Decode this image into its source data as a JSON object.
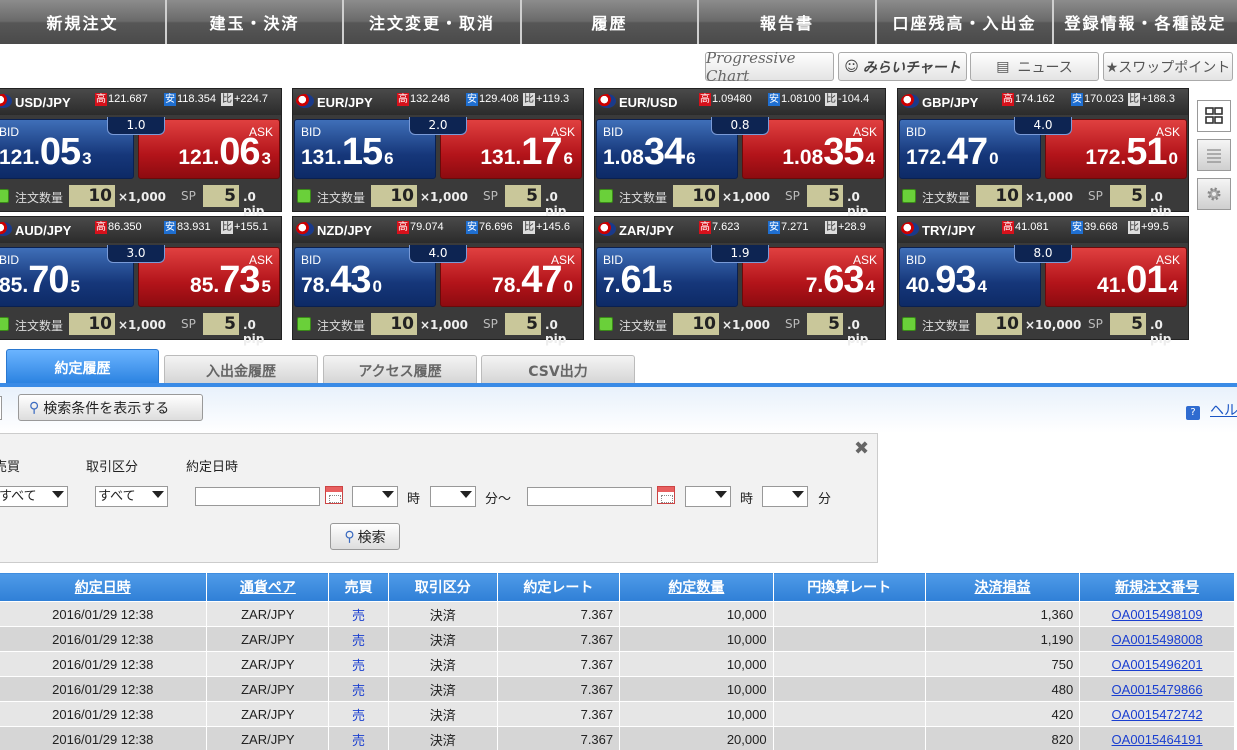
{
  "nav": [
    "新規注文",
    "建玉・決済",
    "注文変更・取消",
    "履歴",
    "報告書",
    "口座残高・入出金",
    "登録情報・各種設定"
  ],
  "tools": {
    "progressive": "Progressive Chart",
    "mirai": "みらいチャート",
    "news": "ニュース",
    "swap": "★スワップポイント"
  },
  "panels": [
    {
      "pair": "USD/JPY",
      "hi": "121.687",
      "lo": "118.354",
      "ch": "+224.7",
      "spread": "1.0",
      "bid": {
        "s": "121.",
        "b": "05",
        "t": "3"
      },
      "ask": {
        "s": "121.",
        "b": "06",
        "t": "3"
      },
      "qty": "10",
      "unit": "×1,000",
      "sp": "5",
      "sp_unit": ".0 pip"
    },
    {
      "pair": "EUR/JPY",
      "hi": "132.248",
      "lo": "129.408",
      "ch": "+119.3",
      "spread": "2.0",
      "bid": {
        "s": "131.",
        "b": "15",
        "t": "6"
      },
      "ask": {
        "s": "131.",
        "b": "17",
        "t": "6"
      },
      "qty": "10",
      "unit": "×1,000",
      "sp": "5",
      "sp_unit": ".0 pip"
    },
    {
      "pair": "EUR/USD",
      "hi": "1.09480",
      "lo": "1.08100",
      "ch": "-104.4",
      "spread": "0.8",
      "bid": {
        "s": "1.08",
        "b": "34",
        "t": "6"
      },
      "ask": {
        "s": "1.08",
        "b": "35",
        "t": "4"
      },
      "qty": "10",
      "unit": "×1,000",
      "sp": "5",
      "sp_unit": ".0 pip"
    },
    {
      "pair": "GBP/JPY",
      "hi": "174.162",
      "lo": "170.023",
      "ch": "+188.3",
      "spread": "4.0",
      "bid": {
        "s": "172.",
        "b": "47",
        "t": "0"
      },
      "ask": {
        "s": "172.",
        "b": "51",
        "t": "0"
      },
      "qty": "10",
      "unit": "×1,000",
      "sp": "5",
      "sp_unit": ".0 pip"
    },
    {
      "pair": "AUD/JPY",
      "hi": "86.350",
      "lo": "83.931",
      "ch": "+155.1",
      "spread": "3.0",
      "bid": {
        "s": "85.",
        "b": "70",
        "t": "5"
      },
      "ask": {
        "s": "85.",
        "b": "73",
        "t": "5"
      },
      "qty": "10",
      "unit": "×1,000",
      "sp": "5",
      "sp_unit": ".0 pip"
    },
    {
      "pair": "NZD/JPY",
      "hi": "79.074",
      "lo": "76.696",
      "ch": "+145.6",
      "spread": "4.0",
      "bid": {
        "s": "78.",
        "b": "43",
        "t": "0"
      },
      "ask": {
        "s": "78.",
        "b": "47",
        "t": "0"
      },
      "qty": "10",
      "unit": "×1,000",
      "sp": "5",
      "sp_unit": ".0 pip"
    },
    {
      "pair": "ZAR/JPY",
      "hi": "7.623",
      "lo": "7.271",
      "ch": "+28.9",
      "spread": "1.9",
      "bid": {
        "s": "7.",
        "b": "61",
        "t": "5"
      },
      "ask": {
        "s": "7.",
        "b": "63",
        "t": "4"
      },
      "qty": "10",
      "unit": "×1,000",
      "sp": "5",
      "sp_unit": ".0 pip"
    },
    {
      "pair": "TRY/JPY",
      "hi": "41.081",
      "lo": "39.668",
      "ch": "+99.5",
      "spread": "8.0",
      "bid": {
        "s": "40.",
        "b": "93",
        "t": "4"
      },
      "ask": {
        "s": "41.",
        "b": "01",
        "t": "4"
      },
      "qty": "10",
      "unit": "×10,000",
      "sp": "5",
      "sp_unit": ".0 pip"
    }
  ],
  "labels": {
    "hi": "高",
    "lo": "安",
    "ch": "比",
    "bid": "BID",
    "ask": "ASK",
    "qty": "注文数量",
    "sp": "SP"
  },
  "tabs": [
    "約定履歴",
    "入出金履歴",
    "アクセス履歴",
    "CSV出力"
  ],
  "search_toggle": "検索条件を表示する",
  "help": "ヘルプ",
  "filter": {
    "buy_sell_label": "売買",
    "trade_type_label": "取引区分",
    "date_label": "約定日時",
    "buy_sell_value": "すべて",
    "trade_type_value": "すべて",
    "hour": "時",
    "minute": "分～",
    "minute_end": "分",
    "search_button": "検索",
    "close": "✖"
  },
  "table": {
    "headers": [
      "約定日時",
      "通貨ペア",
      "売買",
      "取引区分",
      "約定レート",
      "約定数量",
      "円換算レート",
      "決済損益",
      "新規注文番号"
    ],
    "rows": [
      {
        "date": "2016/01/29 12:38",
        "pair": "ZAR/JPY",
        "side": "売",
        "type": "決済",
        "rate": "7.367",
        "qty": "10,000",
        "yen": "",
        "pl": "1,360",
        "order": "OA0015498109"
      },
      {
        "date": "2016/01/29 12:38",
        "pair": "ZAR/JPY",
        "side": "売",
        "type": "決済",
        "rate": "7.367",
        "qty": "10,000",
        "yen": "",
        "pl": "1,190",
        "order": "OA0015498008"
      },
      {
        "date": "2016/01/29 12:38",
        "pair": "ZAR/JPY",
        "side": "売",
        "type": "決済",
        "rate": "7.367",
        "qty": "10,000",
        "yen": "",
        "pl": "750",
        "order": "OA0015496201"
      },
      {
        "date": "2016/01/29 12:38",
        "pair": "ZAR/JPY",
        "side": "売",
        "type": "決済",
        "rate": "7.367",
        "qty": "10,000",
        "yen": "",
        "pl": "480",
        "order": "OA0015479866"
      },
      {
        "date": "2016/01/29 12:38",
        "pair": "ZAR/JPY",
        "side": "売",
        "type": "決済",
        "rate": "7.367",
        "qty": "10,000",
        "yen": "",
        "pl": "420",
        "order": "OA0015472742"
      },
      {
        "date": "2016/01/29 12:38",
        "pair": "ZAR/JPY",
        "side": "売",
        "type": "決済",
        "rate": "7.367",
        "qty": "20,000",
        "yen": "",
        "pl": "820",
        "order": "OA0015464191"
      }
    ]
  },
  "colors": {
    "bid": "#16377a",
    "ask": "#b3141a",
    "tab_active": "#2f7fd6",
    "header": "#2f7fd6"
  }
}
